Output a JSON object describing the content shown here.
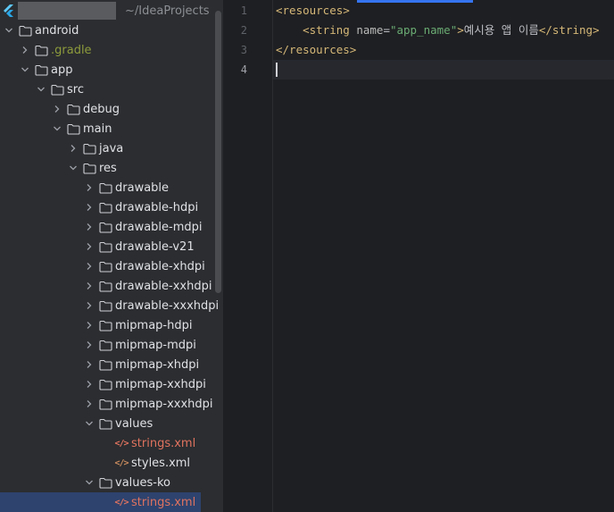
{
  "project": {
    "root_path": "~/IdeaProjects",
    "tree": [
      {
        "label": "android",
        "depth": 0,
        "expanded": true,
        "kind": "folder"
      },
      {
        "label": ".gradle",
        "depth": 1,
        "expanded": false,
        "kind": "folder",
        "style": "gradle"
      },
      {
        "label": "app",
        "depth": 1,
        "expanded": true,
        "kind": "folder"
      },
      {
        "label": "src",
        "depth": 2,
        "expanded": true,
        "kind": "folder"
      },
      {
        "label": "debug",
        "depth": 3,
        "expanded": false,
        "kind": "folder"
      },
      {
        "label": "main",
        "depth": 3,
        "expanded": true,
        "kind": "folder"
      },
      {
        "label": "java",
        "depth": 4,
        "expanded": false,
        "kind": "folder"
      },
      {
        "label": "res",
        "depth": 4,
        "expanded": true,
        "kind": "folder"
      },
      {
        "label": "drawable",
        "depth": 5,
        "expanded": false,
        "kind": "folder"
      },
      {
        "label": "drawable-hdpi",
        "depth": 5,
        "expanded": false,
        "kind": "folder"
      },
      {
        "label": "drawable-mdpi",
        "depth": 5,
        "expanded": false,
        "kind": "folder"
      },
      {
        "label": "drawable-v21",
        "depth": 5,
        "expanded": false,
        "kind": "folder"
      },
      {
        "label": "drawable-xhdpi",
        "depth": 5,
        "expanded": false,
        "kind": "folder"
      },
      {
        "label": "drawable-xxhdpi",
        "depth": 5,
        "expanded": false,
        "kind": "folder"
      },
      {
        "label": "drawable-xxxhdpi",
        "depth": 5,
        "expanded": false,
        "kind": "folder"
      },
      {
        "label": "mipmap-hdpi",
        "depth": 5,
        "expanded": false,
        "kind": "folder"
      },
      {
        "label": "mipmap-mdpi",
        "depth": 5,
        "expanded": false,
        "kind": "folder"
      },
      {
        "label": "mipmap-xhdpi",
        "depth": 5,
        "expanded": false,
        "kind": "folder"
      },
      {
        "label": "mipmap-xxhdpi",
        "depth": 5,
        "expanded": false,
        "kind": "folder"
      },
      {
        "label": "mipmap-xxxhdpi",
        "depth": 5,
        "expanded": false,
        "kind": "folder"
      },
      {
        "label": "values",
        "depth": 5,
        "expanded": true,
        "kind": "folder"
      },
      {
        "label": "strings.xml",
        "depth": 6,
        "kind": "xml",
        "style": "modified"
      },
      {
        "label": "styles.xml",
        "depth": 6,
        "kind": "xml"
      },
      {
        "label": "values-ko",
        "depth": 5,
        "expanded": true,
        "kind": "folder"
      },
      {
        "label": "strings.xml",
        "depth": 6,
        "kind": "xml",
        "style": "modified",
        "selected": true
      }
    ]
  },
  "editor": {
    "line_numbers": [
      "1",
      "2",
      "3",
      "4"
    ],
    "current_line": 4,
    "lines": [
      [
        {
          "t": "tag",
          "s": "<resources>"
        }
      ],
      [
        {
          "t": "txt",
          "s": "    "
        },
        {
          "t": "tag",
          "s": "<string "
        },
        {
          "t": "attr",
          "s": "name"
        },
        {
          "t": "txt",
          "s": "="
        },
        {
          "t": "val",
          "s": "\"app_name\""
        },
        {
          "t": "tag",
          "s": ">"
        },
        {
          "t": "txt",
          "s": "예시용 앱 이름"
        },
        {
          "t": "tag",
          "s": "</string>"
        }
      ],
      [
        {
          "t": "tag",
          "s": "</resources>"
        }
      ],
      []
    ]
  },
  "colors": {
    "accent": "#3574f0",
    "selection": "#2e436e",
    "xml_tag": "#d5b778",
    "xml_value": "#6aab73",
    "modified_file": "#e0735f",
    "gradle_folder": "#8e9b3c"
  },
  "icons": {
    "project_icon": "flutter-icon",
    "folder": "folder-icon",
    "xml_file": "xml-file-icon",
    "expand": "chevron-down-icon",
    "collapse": "chevron-right-icon"
  }
}
